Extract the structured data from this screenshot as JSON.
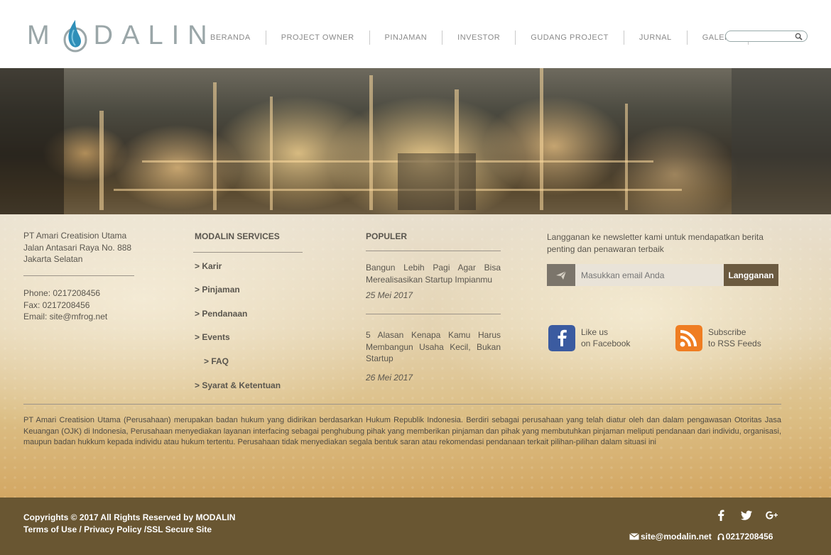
{
  "brand": {
    "name": "MODALIN",
    "logo_left": "M",
    "logo_right": "DALIN"
  },
  "nav": {
    "items": [
      {
        "label": "BERANDA"
      },
      {
        "label": "PROJECT OWNER"
      },
      {
        "label": "PINJAMAN"
      },
      {
        "label": "INVESTOR"
      },
      {
        "label": "GUDANG PROJECT"
      },
      {
        "label": "JURNAL"
      },
      {
        "label": "GALERI"
      }
    ],
    "search_placeholder": ""
  },
  "address": {
    "company": "PT Amari Creatision Utama",
    "street": "Jalan Antasari Raya No. 888",
    "city": "Jakarta Selatan"
  },
  "contact": {
    "phone": "Phone: 0217208456",
    "fax": "Fax: 0217208456",
    "email": "Email: site@mfrog.net"
  },
  "services": {
    "title": "MODALIN SERVICES",
    "items": [
      "> Karir",
      "> Pinjaman",
      "> Pendanaan",
      "> Events",
      "> FAQ",
      "> Syarat & Ketentuan"
    ]
  },
  "popular": {
    "title": "POPULER",
    "posts": [
      {
        "title": "Bangun Lebih Pagi Agar Bisa Merealisasikan Startup Impianmu",
        "date": "25 Mei 2017"
      },
      {
        "title": "5 Alasan Kenapa Kamu Harus Membangun Usaha Kecil, Bukan Startup",
        "date": "26 Mei 2017"
      }
    ]
  },
  "newsletter": {
    "text": "Langganan ke newsletter kami untuk mendapatkan berita penting dan penawaran terbaik",
    "placeholder": "Masukkan email Anda",
    "button": "Langganan"
  },
  "social": {
    "facebook": {
      "line1": "Like us",
      "line2": "on Facebook"
    },
    "rss": {
      "line1": "Subscribe",
      "line2": "to RSS Feeds"
    }
  },
  "legal": "PT Amari Creatision Utama (Perusahaan) merupakan badan hukum yang didirikan berdasarkan Hukum Republik Indonesia. Berdiri sebagai perusahaan yang telah diatur oleh dan dalam pengawasan Otoritas Jasa Keuangan (OJK) di Indonesia, Perusahaan menyediakan layanan interfacing sebagai penghubung pihak yang memberikan pinjaman dan pihak yang membutuhkan pinjaman meliputi pendanaan dari individu, organisasi, maupun badan hukkum kepada individu atau hukum  tertentu. Perusahaan tidak menyediakan segala bentuk saran atau rekomendasi pendanaan terkait pilihan-pilihan dalam situasi ini",
  "footer": {
    "copyright": "Copyrights © 2017 All Rights Reserved by MODALIN",
    "terms": "Terms of Use",
    "sep1": " / ",
    "privacy": "Privacy Policy",
    "sep2": " /",
    "ssl": "SSL Secure Site",
    "email": "site@modalin.net",
    "phone": "0217208456"
  },
  "colors": {
    "bottom_bar": "#695632",
    "accent_button": "#6b5a40",
    "logo_blue": "#2f8fb8"
  }
}
